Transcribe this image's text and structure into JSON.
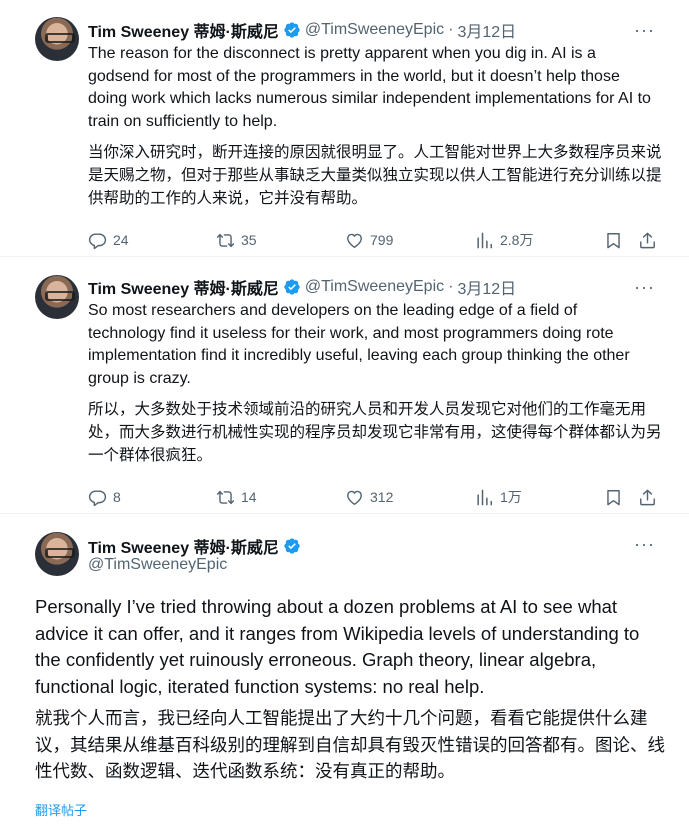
{
  "colors": {
    "accent": "#1d9bf0",
    "text": "#0f1419",
    "muted": "#536471",
    "divider": "#eff3f4"
  },
  "tweets": [
    {
      "author_name": "Tim Sweeney 蒂姆·斯威尼",
      "handle": "@TimSweeneyEpic",
      "dot": "·",
      "date": "3月12日",
      "text": "The reason for the disconnect is pretty apparent when you dig in. AI is a godsend for most of the programmers in the world, but it doesn’t help those doing work which lacks numerous similar independent implementations for AI to train on sufficiently to help.",
      "translation": "当你深入研究时，断开连接的原因就很明显了。人工智能对世界上大多数程序员来说是天赐之物，但对于那些从事缺乏大量类似独立实现以供人工智能进行充分训练以提供帮助的工作的人来说，它并没有帮助。",
      "replies": "24",
      "reposts": "35",
      "likes": "799",
      "views": "2.8万"
    },
    {
      "author_name": "Tim Sweeney 蒂姆·斯威尼",
      "handle": "@TimSweeneyEpic",
      "dot": "·",
      "date": "3月12日",
      "text": "So most researchers and developers on the leading edge of a field of technology find it useless for their work, and most programmers doing rote implementation find it incredibly useful, leaving each group thinking the other group is crazy.",
      "translation": "所以，大多数处于技术领域前沿的研究人员和开发人员发现它对他们的工作毫无用处，而大多数进行机械性实现的程序员却发现它非常有用，这使得每个群体都认为另一个群体很疯狂。",
      "replies": "8",
      "reposts": "14",
      "likes": "312",
      "views": "1万"
    },
    {
      "author_name": "Tim Sweeney 蒂姆·斯威尼",
      "handle": "@TimSweeneyEpic",
      "text": "Personally I’ve tried throwing about a dozen problems at AI to see what advice it can offer, and it ranges from Wikipedia levels of understanding to the confidently yet ruinously erroneous. Graph theory, linear algebra, functional logic, iterated function systems: no real help.",
      "translation": "就我个人而言，我已经向人工智能提出了大约十几个问题，看看它能提供什么建议，其结果从维基百科级别的理解到自信却具有毁灭性错误的回答都有。图论、线性代数、函数逻辑、迭代函数系统：没有真正的帮助。",
      "translate_link": "翻译帖子"
    }
  ]
}
